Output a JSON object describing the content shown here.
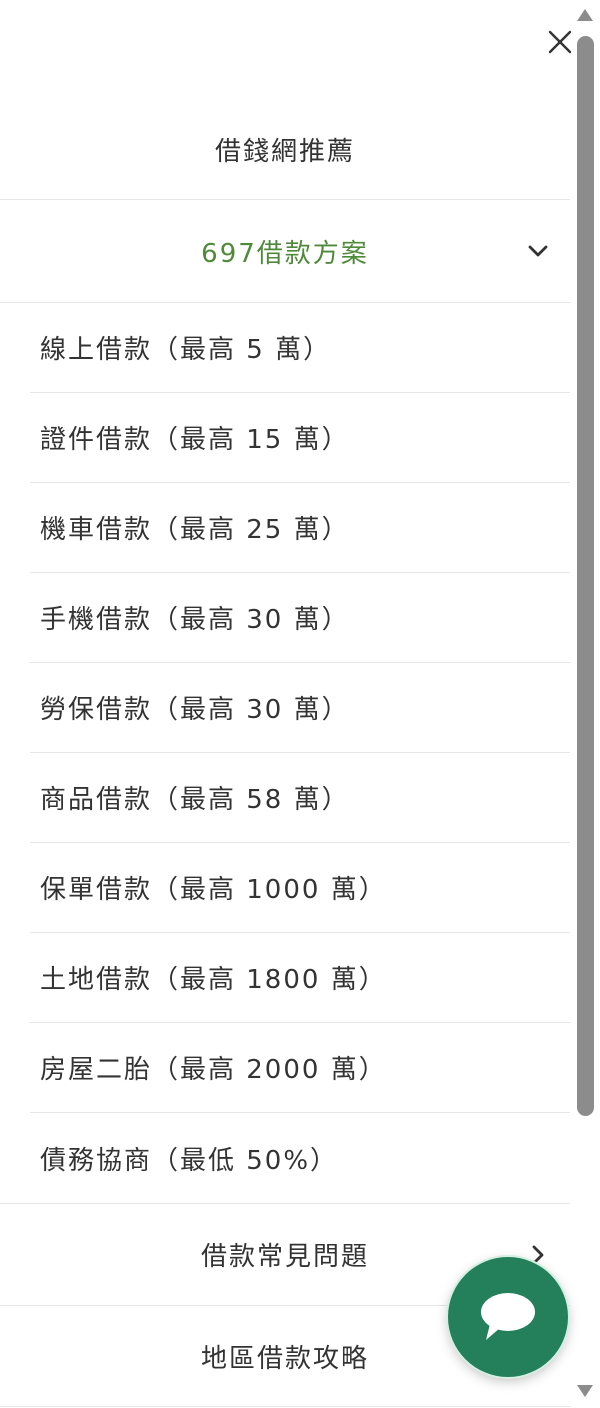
{
  "menu": {
    "title": "借錢網推薦",
    "group": {
      "label": "697借款方案",
      "expanded": true,
      "items": [
        {
          "label": "線上借款（最高 5 萬）"
        },
        {
          "label": "證件借款（最高 15 萬）"
        },
        {
          "label": "機車借款（最高 25 萬）"
        },
        {
          "label": "手機借款（最高 30 萬）"
        },
        {
          "label": "勞保借款（最高 30 萬）"
        },
        {
          "label": "商品借款（最高 58 萬）"
        },
        {
          "label": "保單借款（最高 1000 萬）"
        },
        {
          "label": "土地借款（最高 1800 萬）"
        },
        {
          "label": "房屋二胎（最高 2000 萬）"
        },
        {
          "label": "債務協商（最低 50%）"
        }
      ]
    },
    "faq_label": "借款常見問題",
    "region_label": "地區借款攻略"
  },
  "icons": {
    "close": "close-icon",
    "group_toggle": "chevron-down-icon",
    "faq_arrow": "chevron-right-icon",
    "chat": "chat-bubble-icon"
  },
  "colors": {
    "accent_green": "#4f8a3b",
    "chat_button": "#23805b",
    "scrollbar_thumb": "#8c8c8c",
    "divider": "#e6e6e6"
  }
}
